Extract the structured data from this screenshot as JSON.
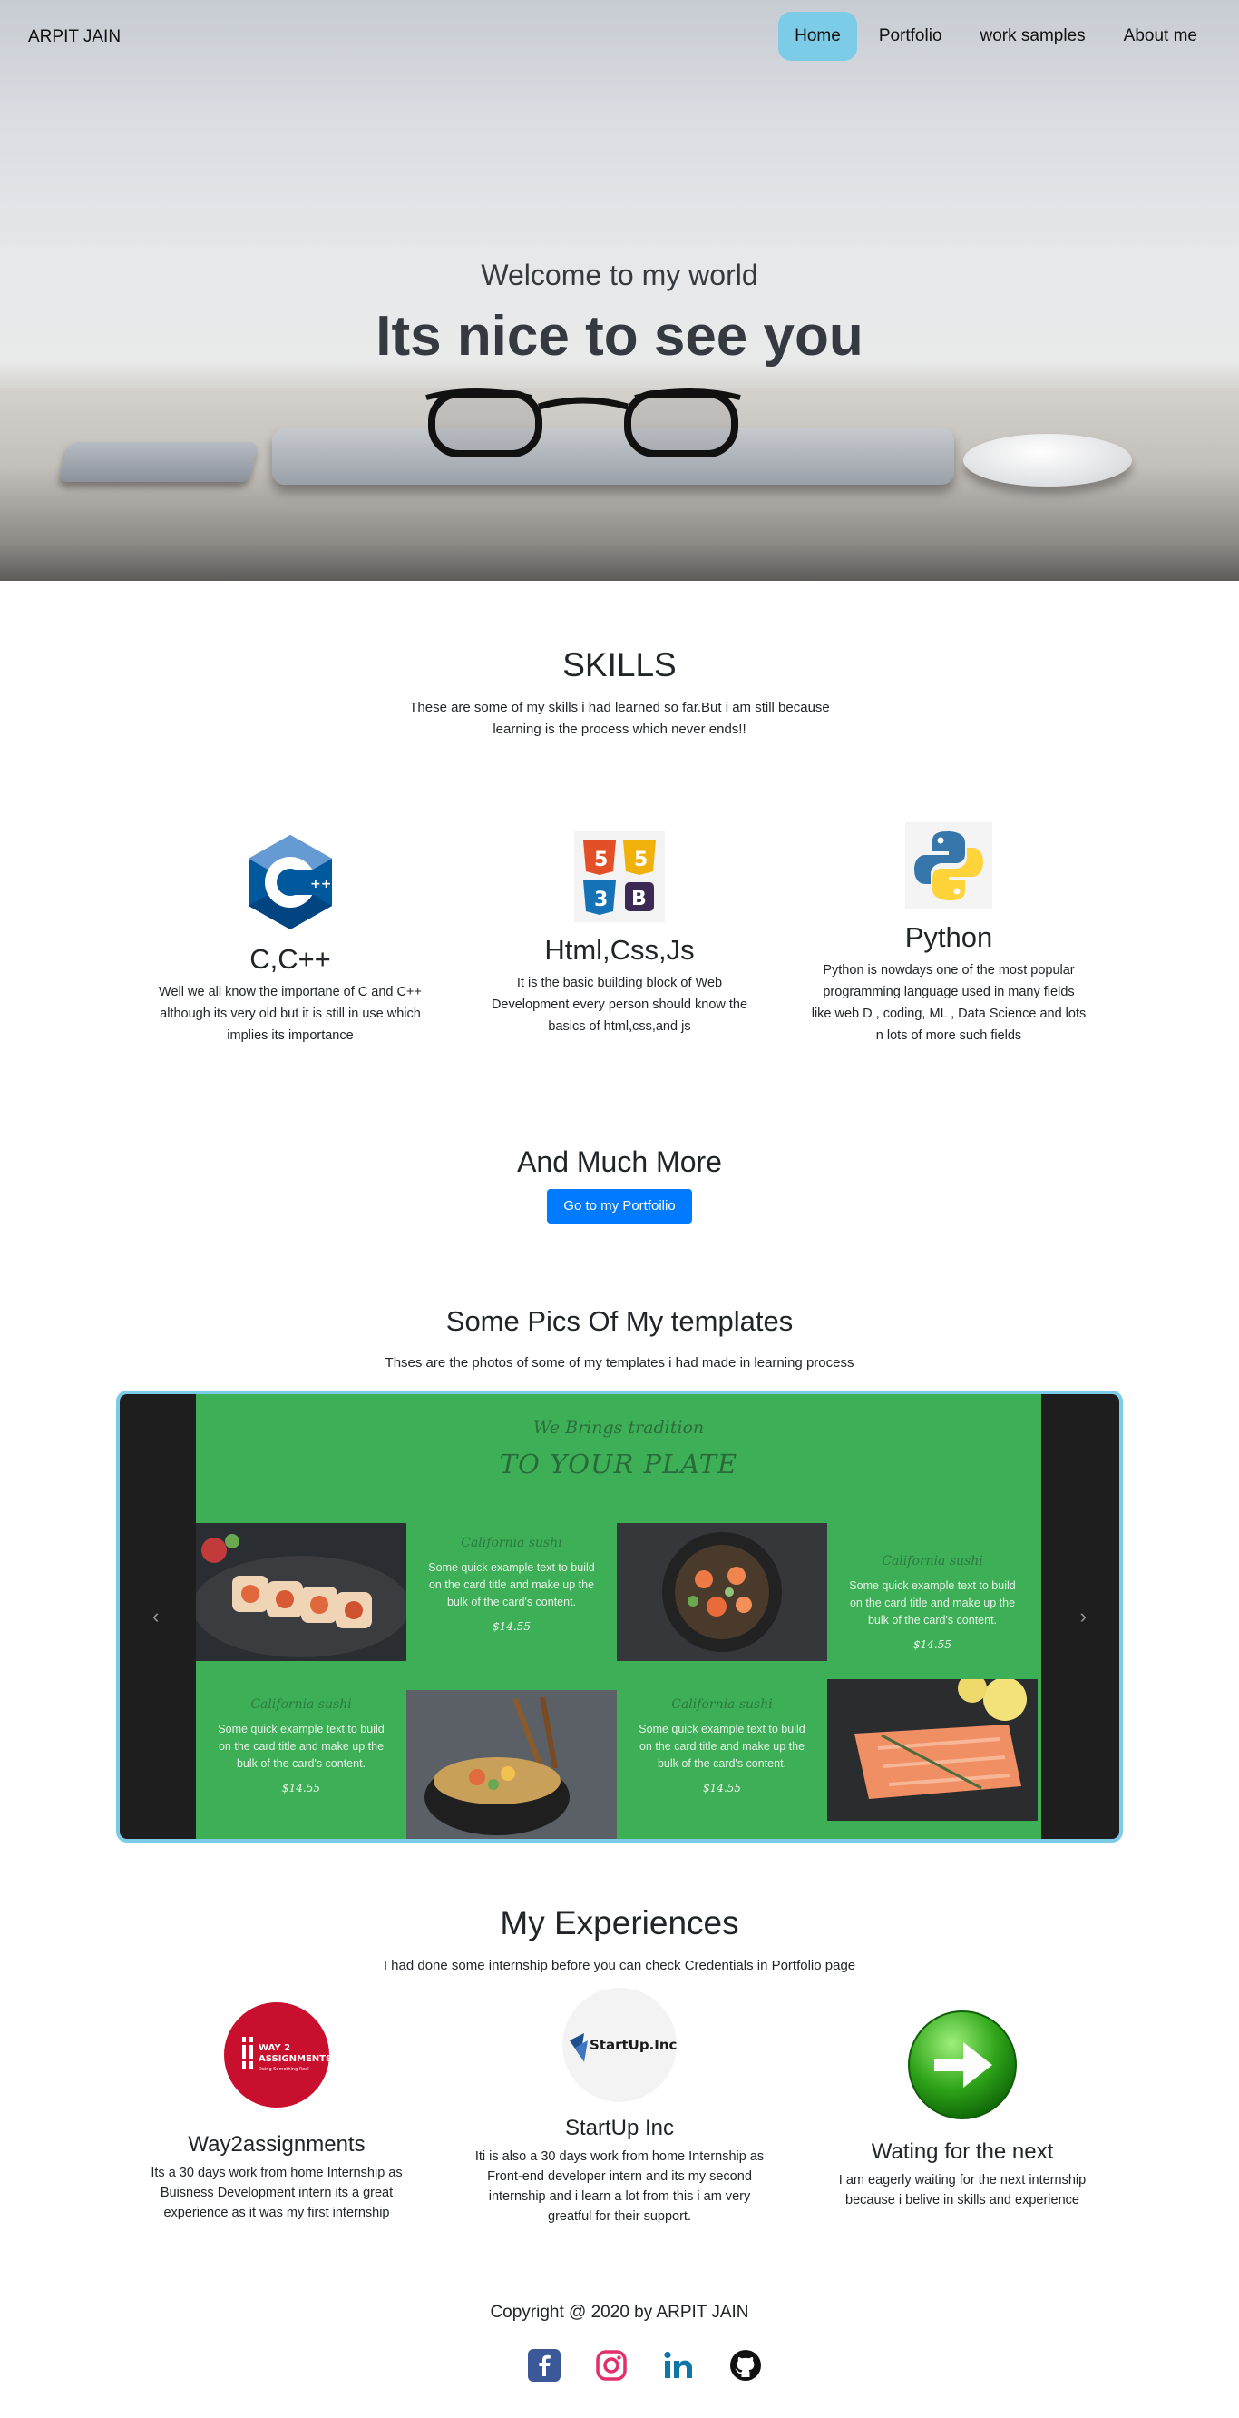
{
  "nav": {
    "brand": "ARPIT JAIN",
    "links": [
      "Home",
      "Portfolio",
      "work samples",
      "About me"
    ],
    "active_color": "#7ccbe7"
  },
  "hero": {
    "subtitle": "Welcome to my world",
    "title": "Its nice to see you"
  },
  "skills": {
    "title": "SKILLS",
    "subtitle_line1": "These are some of my skills i had learned so far.But i am still because",
    "subtitle_line2": "learning is the process which never ends!!",
    "items": [
      {
        "icon": "cpp-icon",
        "title": "C,C++",
        "desc_lines": [
          "Well we all know the importane of C and C++",
          "although its very old but it is still in use which",
          "implies its importance"
        ]
      },
      {
        "icon": "html-css-js-icon",
        "title": "Html,Css,Js",
        "desc_lines": [
          "It is the basic building block of Web",
          "Development every person should know the",
          "basics of html,css,and js"
        ]
      },
      {
        "icon": "python-icon",
        "title": "Python",
        "desc_lines": [
          "Python is nowdays one of the most popular",
          "programming language used in many fields",
          "like web D , coding, ML , Data Science and lots",
          "n lots of more such fields"
        ]
      }
    ]
  },
  "more": {
    "title": "And Much More",
    "button": "Go to my Portfoilio"
  },
  "templates": {
    "title": "Some Pics Of My templates",
    "subtitle": "Thses are the photos of some of my templates i had made in learning process",
    "slide": {
      "kicker": "We Brings tradition",
      "headline": "TO YOUR PLATE",
      "card_title": "California sushi",
      "card_body_lines": [
        "Some quick example text to build",
        "on the card title and make up the",
        "bulk of the card's content."
      ],
      "price": "$14.55"
    },
    "prev": "‹",
    "next": "›"
  },
  "experiences": {
    "title": "My Experiences",
    "subtitle": "I had done some internship before you can check Credentials in Portfolio page",
    "items": [
      {
        "logo_line1": "WAY 2",
        "logo_line2": "ASSIGNMENTS",
        "logo_tag": "Doing Something Real",
        "title": "Way2assignments",
        "desc_lines": [
          "Its a 30 days work from home Internship as",
          "Buisness Development intern its a great",
          "experience as it was my first internship"
        ]
      },
      {
        "logo_text": "StartUp.Inc",
        "title": "StartUp Inc",
        "desc_lines": [
          "Iti is also a 30 days work from home Internship as",
          "Front-end developer intern and its my second",
          "internship and i learn a lot from this i am very",
          "greatful for their support."
        ]
      },
      {
        "icon": "next-arrow-icon",
        "title": "Wating for the next",
        "desc_lines": [
          "I am eagerly waiting for the next internship",
          "because i belive in skills and experience"
        ]
      }
    ]
  },
  "footer": {
    "copyright": "Copyright @ 2020 by ARPIT JAIN",
    "social_icons": [
      "facebook-icon",
      "instagram-icon",
      "linkedin-icon",
      "github-icon"
    ]
  },
  "colors": {
    "primary": "#007bff",
    "accent": "#7ccbe7",
    "slide_green": "#3daf56"
  }
}
